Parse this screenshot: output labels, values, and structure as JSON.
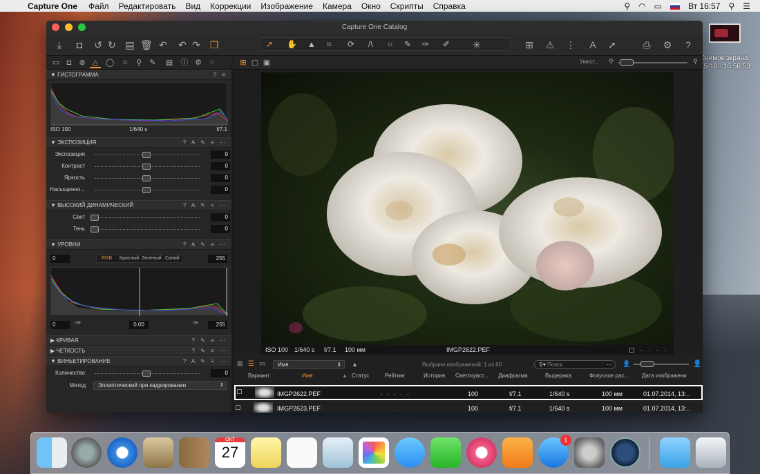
{
  "menubar": {
    "app": "Capture One",
    "items": [
      "Файл",
      "Редактировать",
      "Вид",
      "Коррекции",
      "Изображение",
      "Камера",
      "Окно",
      "Скрипты",
      "Справка"
    ],
    "clock": "Вт 16:57"
  },
  "desktop": {
    "file_label_line1": "Снимок экрана",
    "file_label_line2": "15-10...16.56.53"
  },
  "window": {
    "title": "Capture One Catalog"
  },
  "panels": {
    "histogram": {
      "title": "ГИСТОГРАММА",
      "iso": "ISO 100",
      "shutter": "1/640 s",
      "aperture": "f/7.1"
    },
    "exposure": {
      "title": "ЭКСПОЗИЦИЯ",
      "rows": [
        {
          "label": "Экспозиция",
          "value": "0"
        },
        {
          "label": "Контраст",
          "value": "0"
        },
        {
          "label": "Яркость",
          "value": "0"
        },
        {
          "label": "Насыщенно...",
          "value": "0"
        }
      ]
    },
    "hdr": {
      "title": "ВЫСОКИЙ ДИНАМИЧЕСКИЙ",
      "rows": [
        {
          "label": "Свет",
          "value": "0"
        },
        {
          "label": "Тень",
          "value": "0"
        }
      ]
    },
    "levels": {
      "title": "УРОВНИ",
      "in_low": "0",
      "in_high": "255",
      "channels": [
        "RGB",
        "Красный",
        "Зеленый",
        "Синий"
      ],
      "out_low": "0",
      "mid": "0.00",
      "out_high": "255"
    },
    "curve": {
      "title": "КРИВАЯ"
    },
    "clarity": {
      "title": "ЧЕТКОСТЬ"
    },
    "vignetting": {
      "title": "ВИНЬЕТИРОВАНИЕ",
      "amount_label": "Количество",
      "amount_value": "0",
      "method_label": "Метод",
      "method_value": "Эллиптический при кадрировании"
    }
  },
  "viewer": {
    "zoom_label": "Умест...",
    "iso": "ISO 100",
    "shutter": "1/640 s",
    "aperture": "f/7.1",
    "focal": "100 мм",
    "filename": "IMGP2622.PEF"
  },
  "browser": {
    "sort": "Имя",
    "selected_count": "Выбрано изображений: 1 из 60",
    "search_placeholder": "Поиск",
    "columns": [
      "Вариант",
      "Имя",
      "Статус",
      "Рейтинг",
      "История",
      "Светочувст...",
      "Диафрагма",
      "Выдержка",
      "Фокусное рас...",
      "Дата изображени"
    ],
    "rows": [
      {
        "name": "IMGP2622.PEF",
        "rating": "· · · · ·",
        "iso": "100",
        "aperture": "f/7.1",
        "shutter": "1/640 s",
        "focal": "100 мм",
        "date": "01.07.2014, 13:.."
      },
      {
        "name": "IMGP2623.PEF",
        "rating": "",
        "iso": "100",
        "aperture": "f/7.1",
        "shutter": "1/640 s",
        "focal": "100 мм",
        "date": "01.07.2014, 13:.."
      }
    ]
  },
  "dock": {
    "calendar_month": "ОКТ",
    "calendar_day": "27",
    "appstore_badge": "1"
  }
}
